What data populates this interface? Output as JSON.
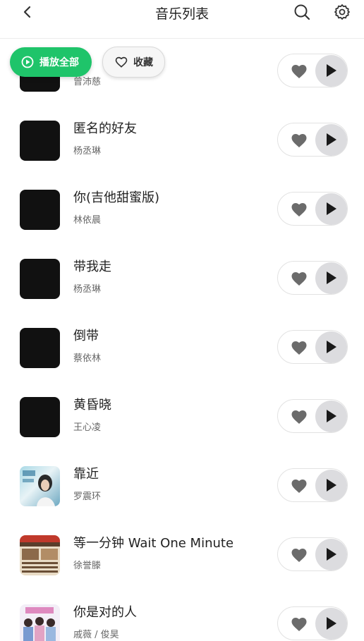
{
  "header": {
    "title": "音乐列表"
  },
  "actions": {
    "play_all": "播放全部",
    "favorite": "收藏"
  },
  "colors": {
    "accent": "#1fc46a",
    "cover_dark": "#111111",
    "play_button_bg": "#dcdcdf",
    "heart": "#6b6b6b"
  },
  "icons": [
    "back-icon",
    "search-icon",
    "gear-icon",
    "play-circle-icon",
    "heart-outline-icon",
    "heart-icon",
    "play-icon"
  ],
  "songs": [
    {
      "title": "",
      "artist": "曾沛慈"
    },
    {
      "title": "匿名的好友",
      "artist": "杨丞琳"
    },
    {
      "title": "你(吉他甜蜜版)",
      "artist": "林依晨"
    },
    {
      "title": "带我走",
      "artist": "杨丞琳"
    },
    {
      "title": "倒带",
      "artist": "蔡依林"
    },
    {
      "title": "黄昏晓",
      "artist": "王心凌"
    },
    {
      "title": "靠近",
      "artist": "罗震环"
    },
    {
      "title": "等一分钟 Wait One Minute",
      "artist": "徐誉滕"
    },
    {
      "title": "你是对的人",
      "artist": "戚薇 / 俊昊"
    }
  ]
}
